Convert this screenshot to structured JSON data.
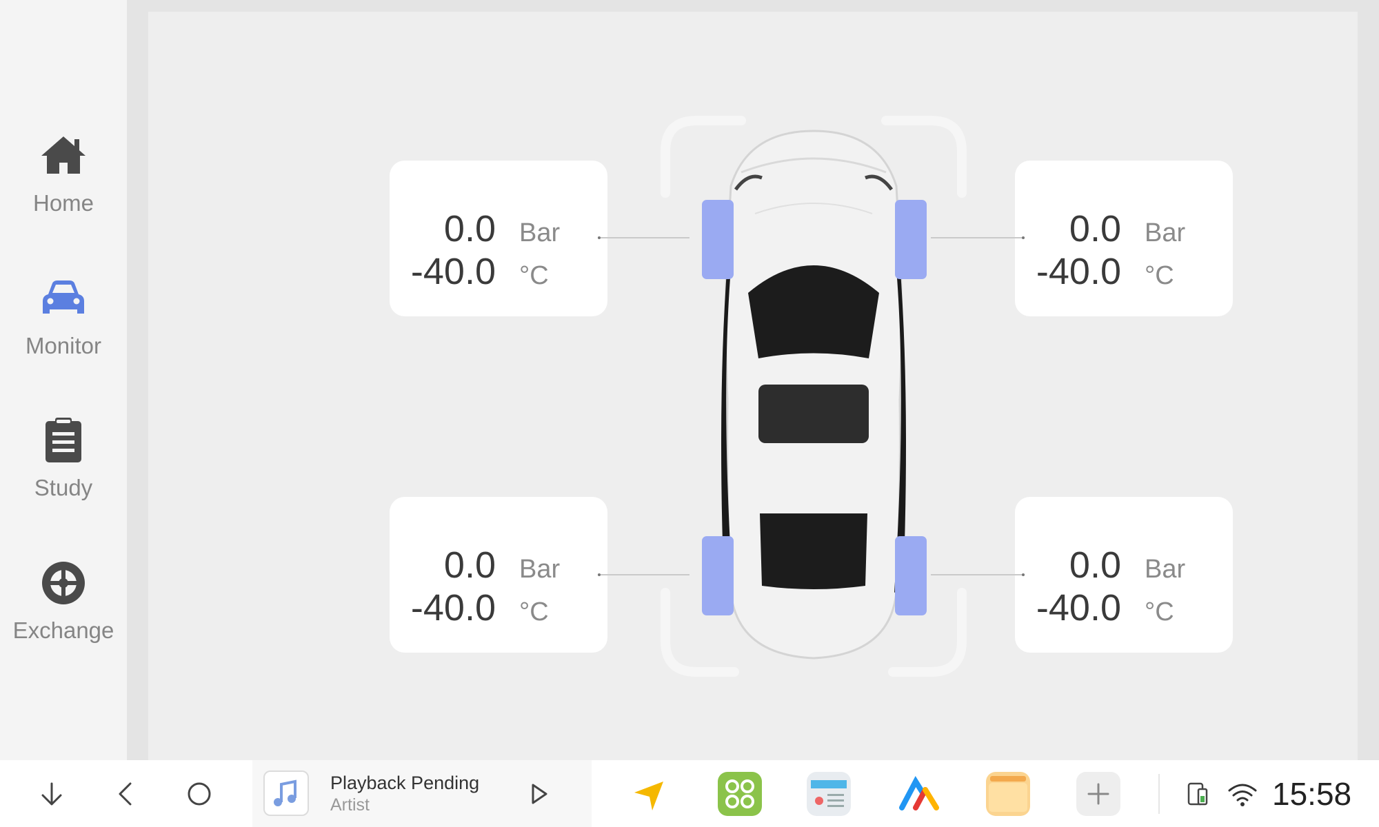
{
  "sidebar": {
    "items": [
      {
        "label": "Home",
        "icon": "home-icon"
      },
      {
        "label": "Monitor",
        "icon": "car-icon",
        "active": true
      },
      {
        "label": "Study",
        "icon": "clipboard-icon"
      },
      {
        "label": "Exchange",
        "icon": "tire-icon"
      }
    ]
  },
  "tires": {
    "front_left": {
      "pressure": "0.0",
      "pressure_unit": "Bar",
      "temp": "-40.0",
      "temp_unit": "°C"
    },
    "front_right": {
      "pressure": "0.0",
      "pressure_unit": "Bar",
      "temp": "-40.0",
      "temp_unit": "°C"
    },
    "rear_left": {
      "pressure": "0.0",
      "pressure_unit": "Bar",
      "temp": "-40.0",
      "temp_unit": "°C"
    },
    "rear_right": {
      "pressure": "0.0",
      "pressure_unit": "Bar",
      "temp": "-40.0",
      "temp_unit": "°C"
    }
  },
  "taskbar": {
    "media": {
      "title": "Playback Pending",
      "artist": "Artist"
    },
    "time": "15:58",
    "apps": [
      "navigation-app-icon",
      "green-apps-icon",
      "radio-app-icon",
      "colorful-app-icon",
      "folder-app-icon",
      "add-app-icon"
    ]
  },
  "colors": {
    "accent": "#5b7fe0",
    "tire": "#9aaaf2"
  }
}
